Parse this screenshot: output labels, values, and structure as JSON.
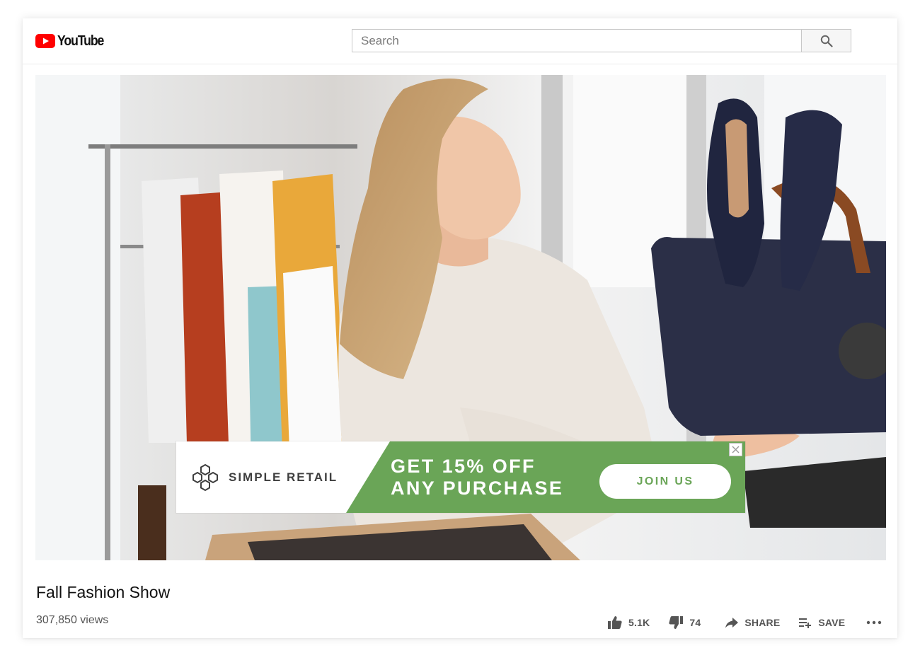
{
  "header": {
    "logo_text": "YouTube",
    "search_placeholder": "Search"
  },
  "ad": {
    "brand": "SIMPLE RETAIL",
    "headline_line1": "GET 15% OFF",
    "headline_line2": "ANY PURCHASE",
    "cta": "JOIN US",
    "accent_color": "#6aa557"
  },
  "video": {
    "title": "Fall Fashion Show",
    "views": "307,850 views"
  },
  "actions": {
    "like_count": "5.1K",
    "dislike_count": "74",
    "share_label": "SHARE",
    "save_label": "SAVE"
  },
  "icons": {
    "logo": "youtube-logo-icon",
    "search": "search-icon",
    "like": "thumbs-up-icon",
    "dislike": "thumbs-down-icon",
    "share": "share-arrow-icon",
    "save": "playlist-add-icon",
    "more": "more-horizontal-icon",
    "close": "close-icon",
    "brand": "hexagon-logo-icon"
  }
}
